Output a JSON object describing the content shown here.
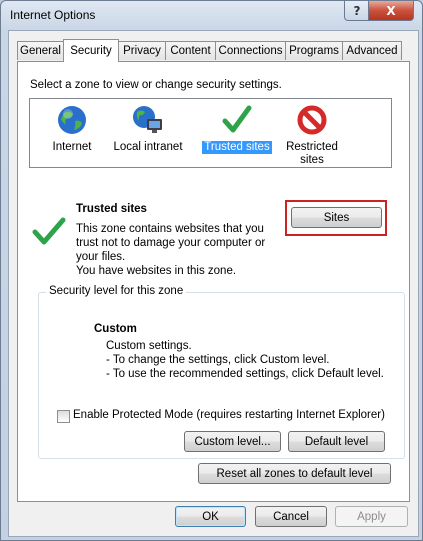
{
  "window": {
    "title": "Internet Options",
    "help_glyph": "?",
    "close_glyph": "X"
  },
  "tabs": [
    {
      "label": "General"
    },
    {
      "label": "Security"
    },
    {
      "label": "Privacy"
    },
    {
      "label": "Content"
    },
    {
      "label": "Connections"
    },
    {
      "label": "Programs"
    },
    {
      "label": "Advanced"
    }
  ],
  "active_tab": "Security",
  "security": {
    "zone_prompt": "Select a zone to view or change security settings.",
    "zones": [
      {
        "label": "Internet",
        "icon": "globe-icon"
      },
      {
        "label": "Local intranet",
        "icon": "intranet-icon"
      },
      {
        "label": "Trusted sites",
        "icon": "checkmark-icon",
        "selected": true
      },
      {
        "label1": "Restricted",
        "label2": "sites",
        "icon": "restricted-icon"
      }
    ],
    "zone_title": "Trusted sites",
    "zone_description": [
      "This zone contains websites that you",
      "trust not to damage your computer or",
      "your files.",
      "You have websites in this zone."
    ],
    "sites_button": "Sites",
    "highlight_color": "#cc2222",
    "level_group_label": "Security level for this zone",
    "level_name": "Custom",
    "level_lines": [
      "Custom settings.",
      "- To change the settings, click Custom level.",
      "- To use the recommended settings, click Default level."
    ],
    "protected_mode_label": "Enable Protected Mode (requires restarting Internet Explorer)",
    "protected_mode_checked": false,
    "custom_level_button": "Custom level...",
    "default_level_button": "Default level",
    "reset_all_button": "Reset all zones to default level"
  },
  "footer": {
    "ok": "OK",
    "cancel": "Cancel",
    "apply": "Apply"
  },
  "colors": {
    "selection": "#3399ff",
    "check_green": "#2ea34a",
    "globe_blue": "#2a6fc9",
    "restricted_red": "#d42a2a"
  }
}
